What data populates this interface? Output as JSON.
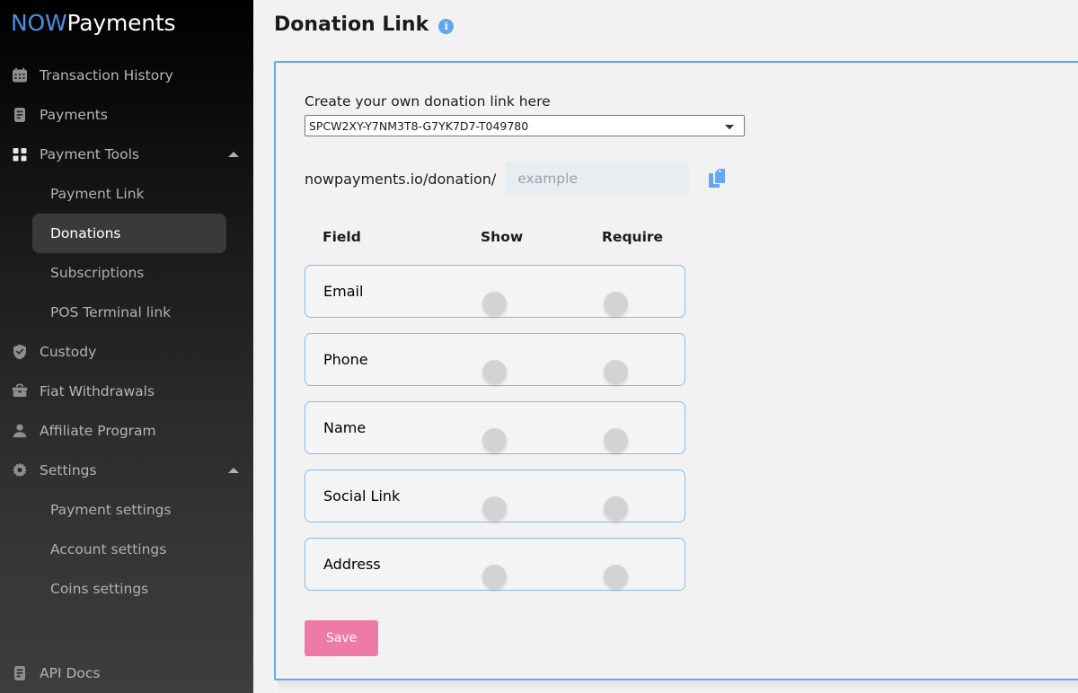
{
  "sidebar": {
    "logo": {
      "part1": "NOW",
      "part2": "Payments",
      "color_accent": "#4a90e2"
    },
    "items": [
      {
        "label": "Transaction History",
        "icon": "calendar-icon",
        "type": "item"
      },
      {
        "label": "Payments",
        "icon": "document-icon",
        "type": "item"
      },
      {
        "label": "Payment Tools",
        "icon": "grid-icon",
        "type": "group",
        "expanded": true
      },
      {
        "label": "Payment Link",
        "type": "sub",
        "active": false
      },
      {
        "label": "Donations",
        "type": "sub",
        "active": true
      },
      {
        "label": "Subscriptions",
        "type": "sub",
        "active": false
      },
      {
        "label": "POS Terminal link",
        "type": "sub",
        "active": false
      },
      {
        "label": "Custody",
        "icon": "shield-check-icon",
        "type": "item"
      },
      {
        "label": "Fiat Withdrawals",
        "icon": "briefcase-icon",
        "type": "item"
      },
      {
        "label": "Affiliate Program",
        "icon": "person-icon",
        "type": "item"
      },
      {
        "label": "Settings",
        "icon": "gear-icon",
        "type": "group",
        "expanded": true
      },
      {
        "label": "Payment settings",
        "type": "sub",
        "active": false
      },
      {
        "label": "Account settings",
        "type": "sub",
        "active": false
      },
      {
        "label": "Coins settings",
        "type": "sub",
        "active": false
      },
      {
        "label": "API Docs",
        "icon": "document-icon",
        "type": "item"
      }
    ]
  },
  "header": {
    "title": "Donation Link",
    "info_icon": "info-icon",
    "info_glyph": "i"
  },
  "form": {
    "select_label": "Create your own donation link here",
    "select_value": "SPCW2XY-Y7NM3T8-G7YK7D7-T049780",
    "select_options": [
      "SPCW2XY-Y7NM3T8-G7YK7D7-T049780"
    ],
    "url_prefix": "nowpayments.io/donation/",
    "slug_value": "",
    "slug_placeholder": "example",
    "copy_icon": "copy-icon",
    "save_label": "Save",
    "save_color": "#ee7ba6"
  },
  "table": {
    "headers": {
      "field": "Field",
      "show": "Show",
      "require": "Require"
    },
    "rows": [
      {
        "field": "Email",
        "show": false,
        "require": false
      },
      {
        "field": "Phone",
        "show": false,
        "require": false
      },
      {
        "field": "Name",
        "show": false,
        "require": false
      },
      {
        "field": "Social Link",
        "show": false,
        "require": false
      },
      {
        "field": "Address",
        "show": false,
        "require": false
      }
    ]
  },
  "colors": {
    "accent_blue": "#64a8f5",
    "card_border": "#64a8f5",
    "row_border": "#82bbf6",
    "background": "#f2f2f2",
    "sidebar_top": "#000000",
    "sidebar_bottom": "#3d3d3d"
  }
}
